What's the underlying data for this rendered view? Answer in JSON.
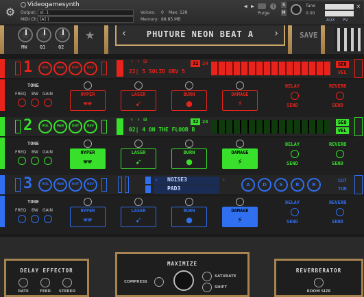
{
  "header": {
    "instrument_name": "Videogamesynth",
    "output_label": "Output:",
    "output_value": "st. 1",
    "midi_label": "MIDI Ch:",
    "midi_value": "[A] 1",
    "voices_label": "Voices:",
    "voices_value": "0",
    "max_label": "Max:",
    "max_value": "128",
    "memory_label": "Memory:",
    "memory_value": "88.85 MB",
    "purge_label": "Purge",
    "tune_label": "Tune",
    "tune_value": "0.00",
    "s_btn": "S",
    "m_btn": "M",
    "aux_btn": "AUX",
    "pv_btn": "PV"
  },
  "top": {
    "knobs": [
      "MW",
      "Q1",
      "Q2"
    ],
    "preset_name": "PHUTURE NEON BEAT A",
    "save_label": "SAVE"
  },
  "channels": [
    {
      "number": "1",
      "color": "#e8231b",
      "ring_labels": [
        "VOL",
        "PAN",
        "OUT",
        "REV"
      ],
      "kit_label": "22| 5 SOLID GRV 5",
      "seq_values": [
        "32",
        "24"
      ],
      "seq_label": "SEQ",
      "vel_label": "VEL",
      "tone_label": "TONE",
      "tone_knobs": [
        "FREQ",
        "BW",
        "GAIN"
      ],
      "fx": [
        "HYPER",
        "LASER",
        "BURN",
        "DAMAGE"
      ],
      "fx_active": [
        false,
        false,
        false,
        false
      ],
      "delay_label": "DELAY",
      "reverb_label": "REVERB",
      "send_label": "SEND"
    },
    {
      "number": "2",
      "color": "#38e02c",
      "ring_labels": [
        "VOL",
        "PAN",
        "OUT",
        "REV"
      ],
      "kit_label": "02| 4 ON THE FLOOR B",
      "seq_values": [
        "32",
        "24"
      ],
      "seq_label": "SEQ",
      "vel_label": "VEL",
      "tone_label": "TONE",
      "tone_knobs": [
        "FREQ",
        "BW",
        "GAIN"
      ],
      "fx": [
        "HYPER",
        "LASER",
        "BURN",
        "DAMAGE"
      ],
      "fx_active": [
        true,
        false,
        false,
        true
      ],
      "delay_label": "DELAY",
      "reverb_label": "REVERB",
      "send_label": "SEND"
    },
    {
      "number": "3",
      "color": "#2f6ff0",
      "ring_labels": [
        "VOL",
        "PAN",
        "OUT",
        "REV"
      ],
      "kit_label": "NOISE3",
      "kit_label_2": "PAD3",
      "env_labels": [
        "A",
        "D",
        "S",
        "R",
        "R"
      ],
      "cut_label": "CUT",
      "tun_label": "TUN",
      "tone_label": "TONE",
      "tone_knobs": [
        "FREQ",
        "BW",
        "GAIN"
      ],
      "fx": [
        "HYPER",
        "LASER",
        "BURN",
        "DAMAGE"
      ],
      "fx_active": [
        false,
        false,
        false,
        true
      ],
      "delay_label": "DELAY",
      "reverb_label": "REVERB",
      "send_label": "SEND"
    }
  ],
  "bottom": {
    "delay": {
      "title": "DELAY EFFECTOR",
      "knobs": [
        "RATE",
        "FEED",
        "STEREO"
      ]
    },
    "maximize": {
      "title": "MAXIMIZE",
      "compress": "COMPRESS",
      "saturate": "SATURATE",
      "shift": "SHIFT"
    },
    "reverb": {
      "title": "REVERBERATOR",
      "knob": "ROOM SIZE"
    }
  }
}
